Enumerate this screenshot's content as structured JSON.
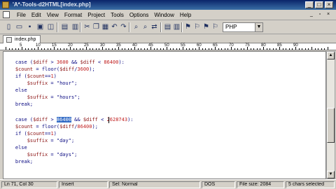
{
  "window": {
    "title": "'A*-Tools-d2HTML[index.php]"
  },
  "menu": {
    "items": [
      {
        "label": "File"
      },
      {
        "label": "Edit"
      },
      {
        "label": "View"
      },
      {
        "label": "Format"
      },
      {
        "label": "Project"
      },
      {
        "label": "Tools"
      },
      {
        "label": "Options"
      },
      {
        "label": "Window"
      },
      {
        "label": "Help"
      }
    ]
  },
  "toolbar": {
    "language": "PHP",
    "icons": [
      "new-file-icon",
      "open-folder-icon",
      "save-icon",
      "save-all-icon",
      "print-icon",
      "print-preview-icon",
      "cut-icon",
      "copy-icon",
      "paste-icon",
      "undo-icon",
      "redo-icon",
      "find-icon",
      "find-next-icon",
      "replace-icon",
      "spell-check-icon",
      "page-icon",
      "page-setup-icon",
      "tag-icon",
      "bookmark-icon",
      "bookmark-next-icon",
      "bookmark-prev-icon",
      "bookmark-clear-icon",
      "options-icon"
    ]
  },
  "tab": {
    "label": "index.php"
  },
  "ruler": {
    "numbers": [
      "5",
      "10",
      "15",
      "20",
      "25",
      "30",
      "35",
      "40",
      "45",
      "50",
      "55",
      "60",
      "65",
      "70",
      "75",
      "80",
      "85",
      "90"
    ]
  },
  "code": {
    "lines": [
      "    case ($diff > 3600 && $diff < 86400):",
      "    $count = floor($diff/3600);",
      "    if ($count==1)",
      "        $suffix = \"hour\";",
      "    else",
      "        $suffix = \"hours\";",
      "    break;",
      "",
      "    case ($diff > 86400 && $diff < 2628743):",
      "    $count = floor($diff/86400);",
      "    if ($count==1)",
      "        $suffix = \"day\";",
      "    else",
      "        $suffix = \"days\";",
      "    break;"
    ],
    "selected_text": "86400"
  },
  "status": {
    "position": "Ln 71, Col 30",
    "mode": "Insert",
    "selection_mode": "Sel: Normal",
    "format": "DOS",
    "file_size": "File size: 2084",
    "selected": "5 chars selected"
  }
}
